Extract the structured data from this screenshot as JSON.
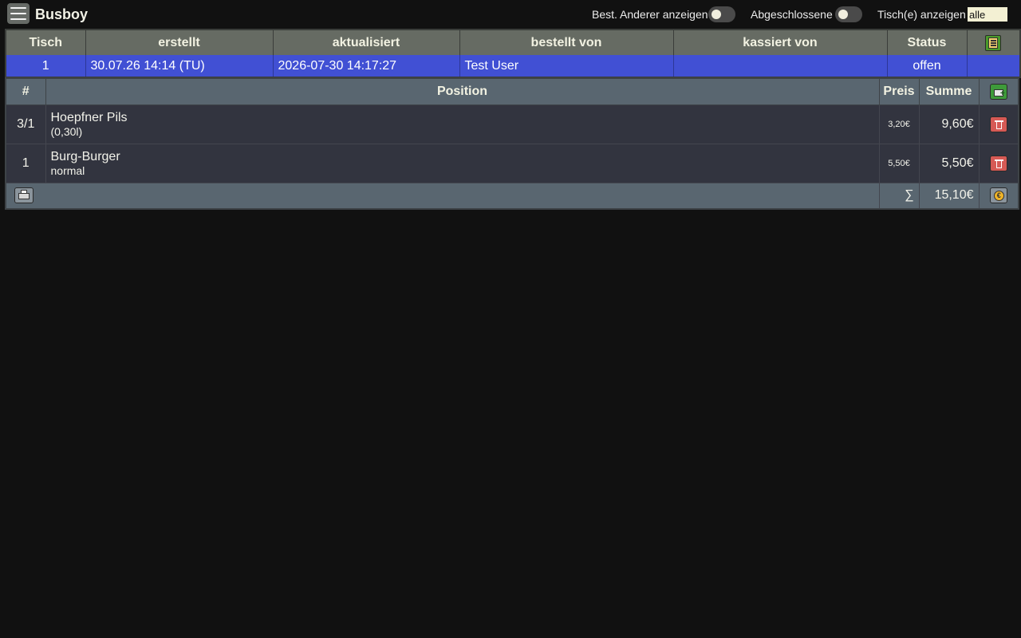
{
  "app": {
    "title": "Busboy"
  },
  "controls": {
    "show_others_label": "Best. Anderer anzeigen",
    "show_others_on": false,
    "show_closed_label": "Abgeschlossene",
    "show_closed_on": false,
    "tables_label": "Tisch(e) anzeigen",
    "tables_value": "alle"
  },
  "orders": {
    "headers": {
      "table": "Tisch",
      "created": "erstellt",
      "updated": "aktualisiert",
      "ordered_by": "bestellt von",
      "cashed_by": "kassiert von",
      "status": "Status"
    },
    "rows": [
      {
        "table": "1",
        "created": "30.07.26 14:14 (TU)",
        "updated": "2026-07-30 14:17:27",
        "ordered_by": "Test User",
        "cashed_by": "",
        "status": "offen"
      }
    ]
  },
  "positions": {
    "headers": {
      "number": "#",
      "position": "Position",
      "price": "Preis",
      "sum": "Summe"
    },
    "items": [
      {
        "qty": "3/1",
        "name": "Hoepfner Pils",
        "variant": "(0,30l)",
        "price": "3,20€",
        "sum": "9,60€"
      },
      {
        "qty": "1",
        "name": "Burg-Burger",
        "variant": "normal",
        "price": "5,50€",
        "sum": "5,50€"
      }
    ],
    "total_symbol": "∑",
    "total": "15,10€"
  },
  "icons": {
    "menu": "hamburger-menu-icon",
    "order_list": "order-list-icon",
    "add_item": "add-item-icon",
    "delete": "trash-icon",
    "print": "printer-icon",
    "pay": "euro-coin-icon"
  },
  "colors": {
    "background": "#111111",
    "selected_row": "#4150d4",
    "orders_header": "#666b63",
    "positions_header": "#596670",
    "positions_row": "#32343f",
    "delete_button": "#d65a55",
    "add_button": "#3e9a3a",
    "input_bg": "#f3f0d3"
  }
}
